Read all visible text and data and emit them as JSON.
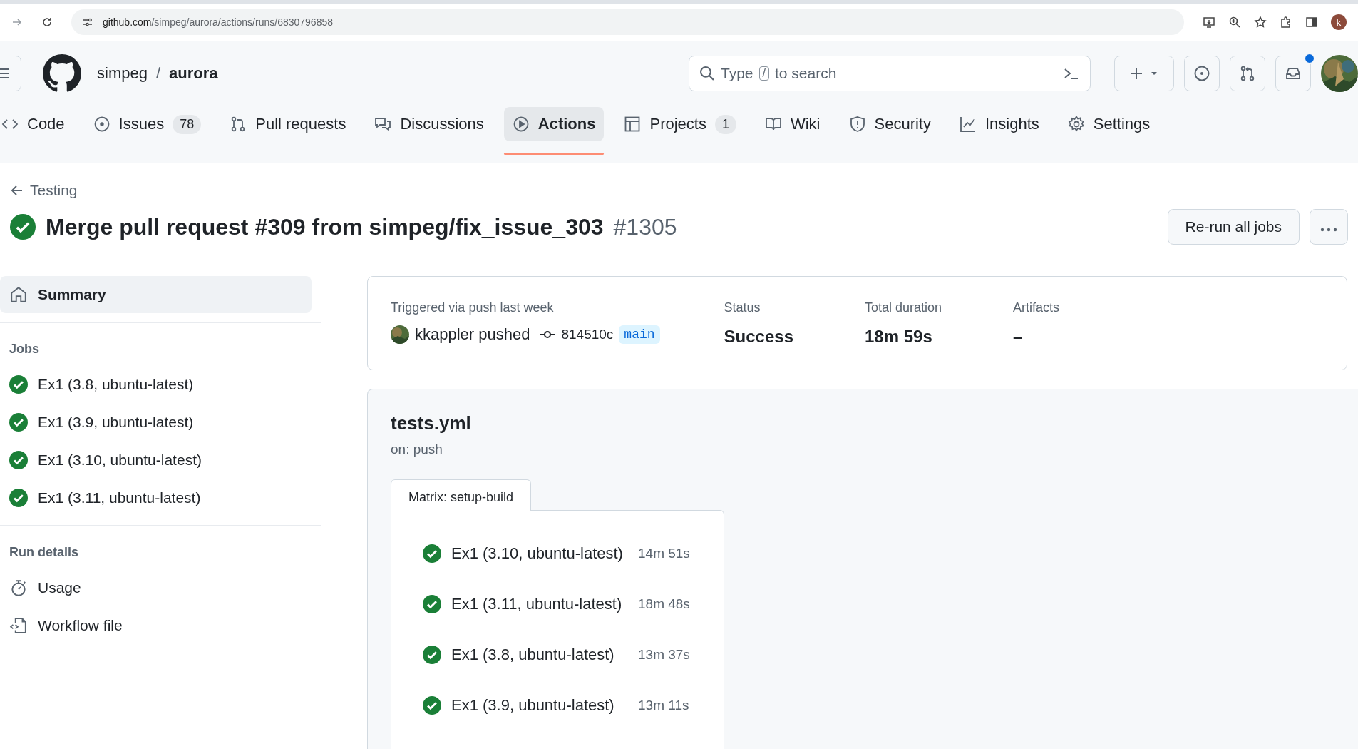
{
  "browser": {
    "url_host": "github.com",
    "url_path": "/simpeg/aurora/actions/runs/6830796858",
    "profile_letter": "k"
  },
  "header": {
    "owner": "simpeg",
    "separator": "/",
    "repo": "aurora",
    "search": {
      "before": "Type",
      "key": "/",
      "after": "to search"
    },
    "notifications_unread": true
  },
  "tabs": [
    {
      "label": "Code",
      "selected": false
    },
    {
      "label": "Issues",
      "count": "78",
      "selected": false
    },
    {
      "label": "Pull requests",
      "selected": false
    },
    {
      "label": "Discussions",
      "selected": false
    },
    {
      "label": "Actions",
      "selected": true
    },
    {
      "label": "Projects",
      "count": "1",
      "selected": false
    },
    {
      "label": "Wiki",
      "selected": false
    },
    {
      "label": "Security",
      "selected": false
    },
    {
      "label": "Insights",
      "selected": false
    },
    {
      "label": "Settings",
      "selected": false
    }
  ],
  "run": {
    "back_link": "Testing",
    "title": "Merge pull request #309 from simpeg/fix_issue_303",
    "number": "#1305",
    "passed": true,
    "rerun_button": "Re-run all jobs"
  },
  "sidebar": {
    "summary": {
      "label": "Summary",
      "selected": true
    },
    "jobs_heading": "Jobs",
    "jobs": [
      {
        "name": "Ex1 (3.8, ubuntu-latest)",
        "passed": true
      },
      {
        "name": "Ex1 (3.9, ubuntu-latest)",
        "passed": true
      },
      {
        "name": "Ex1 (3.10, ubuntu-latest)",
        "passed": true
      },
      {
        "name": "Ex1 (3.11, ubuntu-latest)",
        "passed": true
      }
    ],
    "details_heading": "Run details",
    "details": [
      "Usage",
      "Workflow file"
    ]
  },
  "summary": {
    "trigger": "Triggered via push last week",
    "actor": "kkappler pushed",
    "commit": "814510c",
    "branch": "main",
    "stats": [
      {
        "label": "Status",
        "value": "Success"
      },
      {
        "label": "Total duration",
        "value": "18m 59s"
      },
      {
        "label": "Artifacts",
        "value": "–"
      }
    ]
  },
  "workflow": {
    "name": "tests.yml",
    "trigger": "on: push",
    "matrix": "Matrix: setup-build",
    "jobs": [
      {
        "name": "Ex1 (3.10, ubuntu-latest)",
        "duration": "14m 51s",
        "passed": true
      },
      {
        "name": "Ex1 (3.11, ubuntu-latest)",
        "duration": "18m 48s",
        "passed": true
      },
      {
        "name": "Ex1 (3.8, ubuntu-latest)",
        "duration": "13m 37s",
        "passed": true
      },
      {
        "name": "Ex1 (3.9, ubuntu-latest)",
        "duration": "13m 11s",
        "passed": true
      }
    ]
  }
}
